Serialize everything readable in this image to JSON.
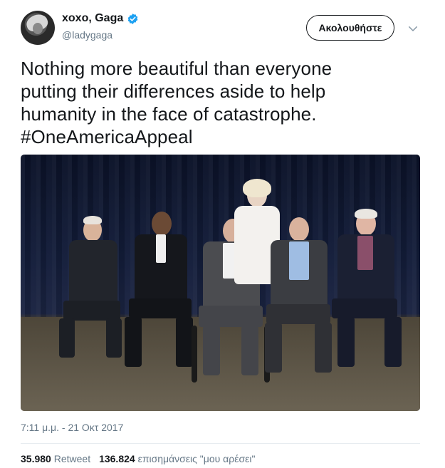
{
  "user": {
    "display_name": "xoxo, Gaga",
    "handle": "@ladygaga",
    "verified": true,
    "avatar_icon": "profile-photo"
  },
  "follow_button": {
    "label": "Ακολουθήστε"
  },
  "menu": {
    "icon": "chevron-down-icon"
  },
  "tweet": {
    "text": "Nothing more beautiful than everyone\nputting their differences aside to help\nhumanity in the face of catastrophe.\n#OneAmericaAppeal"
  },
  "media": {
    "alt": "Photo of six people posing in front of a dark blue curtain"
  },
  "timestamp": "7:11 μ.μ. - 21 Οκτ 2017",
  "stats": {
    "retweets_count": "35.980",
    "retweets_label": "Retweet",
    "likes_count": "136.824",
    "likes_label": "επισημάνσεις \"μου αρέσει\""
  },
  "colors": {
    "text": "#14171a",
    "secondary": "#657786",
    "verified": "#1da1f2",
    "divider": "#e6ecf0"
  }
}
